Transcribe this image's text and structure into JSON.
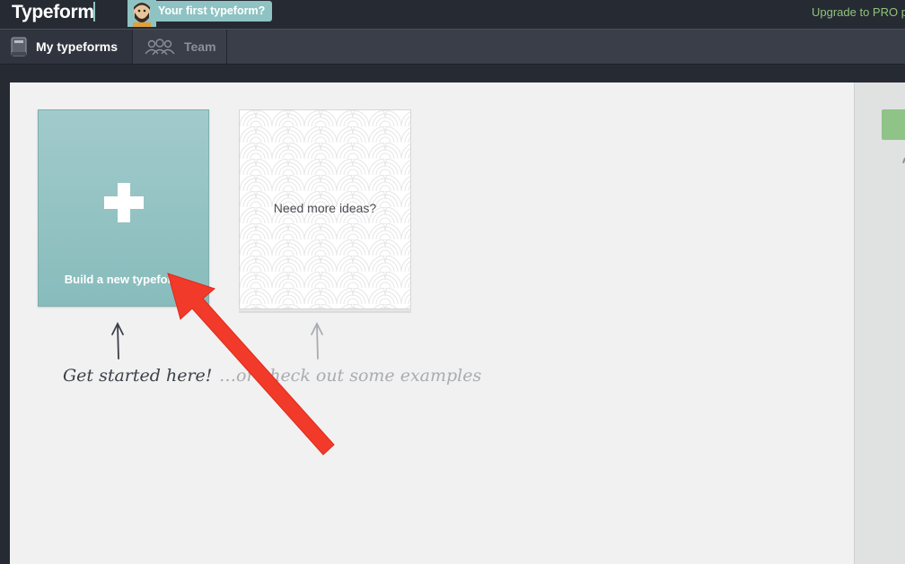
{
  "app": {
    "logo": "Typeform",
    "first_badge": "Your first typeform?",
    "upgrade": "Upgrade to PRO p"
  },
  "nav": {
    "tabs": [
      {
        "label": "My typeforms",
        "icon": "typeform-box-icon",
        "active": true
      },
      {
        "label": "Team",
        "icon": "team-icon",
        "active": false
      }
    ]
  },
  "main": {
    "new_card": {
      "label": "Build a new typeform",
      "icon": "plus-icon"
    },
    "ideas_card": {
      "label": "Need more ideas?"
    },
    "hints": {
      "start": "Get started here!",
      "examples": "…or check out some examples"
    }
  },
  "colors": {
    "accent": "#8fc3c3",
    "upgrade": "#8fc47c",
    "annotation_arrow": "#f23a2a"
  }
}
